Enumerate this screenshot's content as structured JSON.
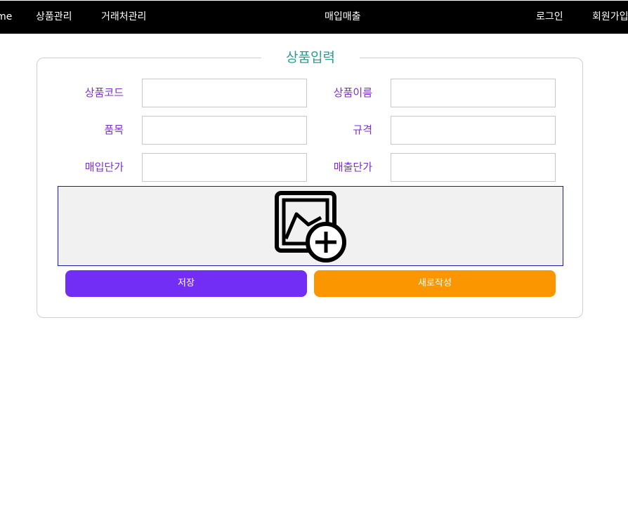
{
  "nav": {
    "home": "Home",
    "product_mgmt": "상품관리",
    "partner_mgmt": "거래처관리",
    "sales": "매입매출",
    "login": "로그인",
    "signup": "회원가입"
  },
  "form": {
    "legend": "상품입력",
    "product_code": {
      "label": "상품코드",
      "value": "",
      "placeholder": ""
    },
    "product_name": {
      "label": "상품이름",
      "value": "",
      "placeholder": ""
    },
    "item": {
      "label": "품목",
      "value": "",
      "placeholder": ""
    },
    "spec": {
      "label": "규격",
      "value": "",
      "placeholder": ""
    },
    "purchase_price": {
      "label": "매입단가",
      "value": "",
      "placeholder": ""
    },
    "sale_price": {
      "label": "매출단가",
      "value": "",
      "placeholder": ""
    },
    "image_upload": {
      "icon": "add-image-icon"
    },
    "save_label": "저장",
    "new_label": "새로작성"
  },
  "colors": {
    "navbar_bg": "#000000",
    "legend": "#2a9d8f",
    "label": "#7a2fd0",
    "save_button": "#722ef5",
    "new_button": "#fb9600",
    "upload_border": "#1a1aa8",
    "upload_bg": "#f1f1f1"
  }
}
